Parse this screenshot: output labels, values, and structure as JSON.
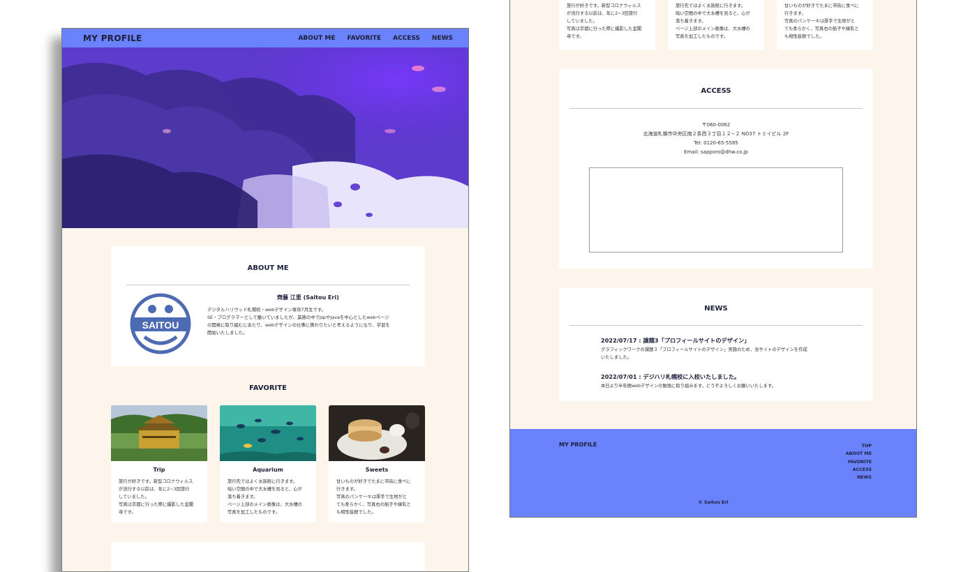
{
  "header": {
    "logo": "MY PROFILE",
    "nav": [
      "ABOUT ME",
      "FAVORITE",
      "ACCESS",
      "NEWS"
    ]
  },
  "about": {
    "title": "ABOUT ME",
    "logo_text": "SAITOU",
    "name": "齊藤 江里 (Saitou Eri)",
    "bio": [
      "デジタルハリウッド札幌校・webデザイン専攻7月生です。",
      "SE・プログラマーとして働いていましたが、業務の中でjspやjavaを中心としたwebページ",
      "の開発に取り組むにあたり、webデザインの仕事に携わりたいと考えるようになり、学習を",
      "開始いたしました。"
    ]
  },
  "favorite": {
    "title": "FAVORITE",
    "items": [
      {
        "name": "Trip",
        "text": [
          "旅行が好きです。新型コロナウィルス",
          "が流行する以前は、年に2~3回旅行",
          "していました。",
          "写真は京都に行った際に撮影した金閣",
          "寺です。"
        ]
      },
      {
        "name": "Aquarium",
        "text": [
          "旅行先ではよく水族館に行きます。",
          "暗い空間の中で大水槽を見ると、心が",
          "落ち着きます。",
          "ページ上部のメイン画像は、大水槽の",
          "写真を加工したものです。"
        ]
      },
      {
        "name": "Sweets",
        "text": [
          "甘いものが好きでたまに市街に食べに",
          "行きます。",
          "写真のパンケーキは厚手で生地がと",
          "ても柔らかく、写真右の餡子や練乳と",
          "も相性抜群でした。"
        ]
      }
    ]
  },
  "access": {
    "title": "ACCESS",
    "lines": [
      "〒060-0062",
      "北海道札幌市中央区南２条西３丁目１２−２ NO37 トミイビル 2F",
      "Tel: 0120-65-5585",
      "Email: sapporo@dhw.co.jp"
    ]
  },
  "news": {
    "title": "NEWS",
    "items": [
      {
        "heading": "2022/07/17 : 課題3「プロフィールサイトのデザイン」",
        "body": [
          "グラフィックワークの課題３「プロフィールサイトのデザイン」実施のため、当サイトのデザインを作成",
          "いたしました。"
        ]
      },
      {
        "heading": "2022/07/01 : デジハリ札幌校に入校いたしました。",
        "body": [
          "本日より半年間webデザインの勉強に取り組みます。どうぞよろしくお願いいたします。"
        ]
      }
    ]
  },
  "footer": {
    "logo": "MY PROFILE",
    "nav": [
      "TOP",
      "ABOUT ME",
      "FAVORITE",
      "ACCESS",
      "NEWS"
    ],
    "copyright": "© Saitou Eri"
  },
  "colors": {
    "header_bg": "#6a82fb",
    "page_bg": "#fdf5ec",
    "card_bg": "#ffffff",
    "logo_blue": "#4d6bb3"
  }
}
